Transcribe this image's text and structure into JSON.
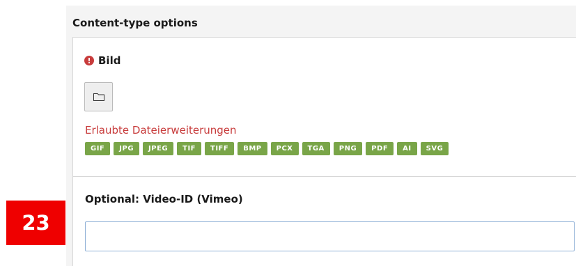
{
  "section": {
    "title": "Content-type options"
  },
  "image_field": {
    "label": "Bild",
    "error_icon": "exclamation-circle-icon",
    "browse_icon": "folder-icon",
    "allowed_label": "Erlaubte Dateierweiterungen",
    "extensions": [
      "GIF",
      "JPG",
      "JPEG",
      "TIF",
      "TIFF",
      "BMP",
      "PCX",
      "TGA",
      "PNG",
      "PDF",
      "AI",
      "SVG"
    ]
  },
  "video_field": {
    "label": "Optional: Video-ID (Vimeo)",
    "value": "",
    "placeholder": ""
  },
  "step_badge": {
    "number": "23"
  },
  "colors": {
    "error": "#c83c3c",
    "badge_green": "#79a548",
    "step_red": "#ef0000",
    "input_border": "#8fb0d6"
  }
}
